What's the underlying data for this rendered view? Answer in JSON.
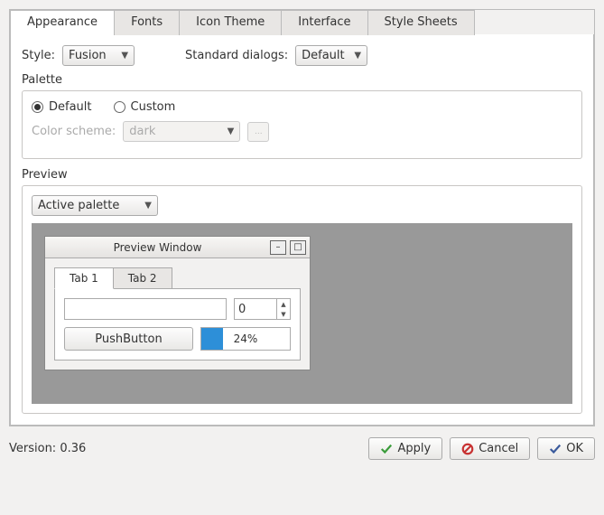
{
  "tabs": {
    "appearance": "Appearance",
    "fonts": "Fonts",
    "icon_theme": "Icon Theme",
    "interface": "Interface",
    "style_sheets": "Style Sheets"
  },
  "style": {
    "label": "Style:",
    "value": "Fusion"
  },
  "standard_dialogs": {
    "label": "Standard dialogs:",
    "value": "Default"
  },
  "palette": {
    "title": "Palette",
    "default": "Default",
    "custom": "Custom",
    "color_scheme_label": "Color scheme:",
    "color_scheme_value": "dark",
    "ellipsis": "..."
  },
  "preview": {
    "title": "Preview",
    "palette_combo": "Active palette",
    "window_title": "Preview Window",
    "tab1": "Tab 1",
    "tab2": "Tab 2",
    "text_value": "",
    "spin_value": "0",
    "push_button": "PushButton",
    "progress_text": "24%"
  },
  "footer": {
    "version": "Version: 0.36",
    "apply": "Apply",
    "cancel": "Cancel",
    "ok": "OK"
  }
}
